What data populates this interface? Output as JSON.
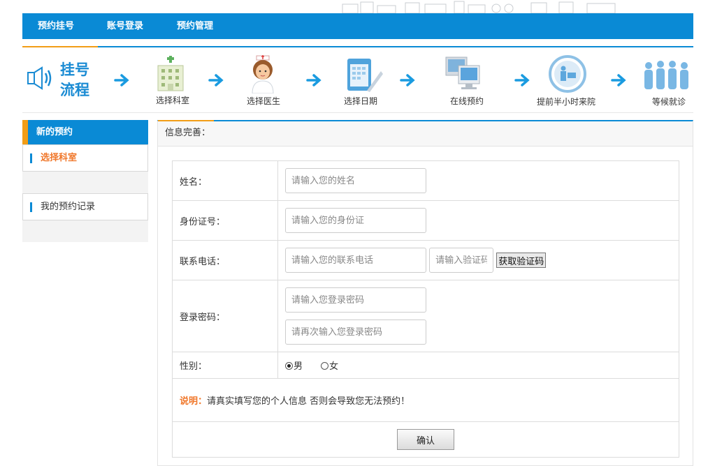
{
  "nav": {
    "items": [
      "预约挂号",
      "账号登录",
      "预约管理"
    ]
  },
  "process": {
    "title_line1": "挂号",
    "title_line2": "流程",
    "steps": [
      "选择科室",
      "选择医生",
      "选择日期",
      "在线预约",
      "提前半小时来院",
      "等候就诊"
    ]
  },
  "sidebar": {
    "header": "新的预约",
    "active_item": "选择科室",
    "records_item": "我的预约记录"
  },
  "main": {
    "header": "信息完善：",
    "name": {
      "label": "姓名：",
      "placeholder": "请输入您的姓名"
    },
    "id_card": {
      "label": "身份证号：",
      "placeholder": "请输入您的身份证"
    },
    "phone": {
      "label": "联系电话：",
      "placeholder": "请输入您的联系电话",
      "code_placeholder": "请输入验证码",
      "code_button": "获取验证码"
    },
    "password": {
      "label": "登录密码：",
      "placeholder": "请输入您登录密码",
      "confirm_placeholder": "请再次输入您登录密码"
    },
    "gender": {
      "label": "性别：",
      "male": "男",
      "female": "女",
      "selected": "男"
    },
    "note": {
      "label": "说明：",
      "text": "请真实填写您的个人信息 否则会导致您无法预约！"
    },
    "submit": "确认"
  },
  "colors": {
    "brand_blue": "#0a8ad5",
    "accent_orange": "#f29d16",
    "note_orange": "#f0772a"
  }
}
